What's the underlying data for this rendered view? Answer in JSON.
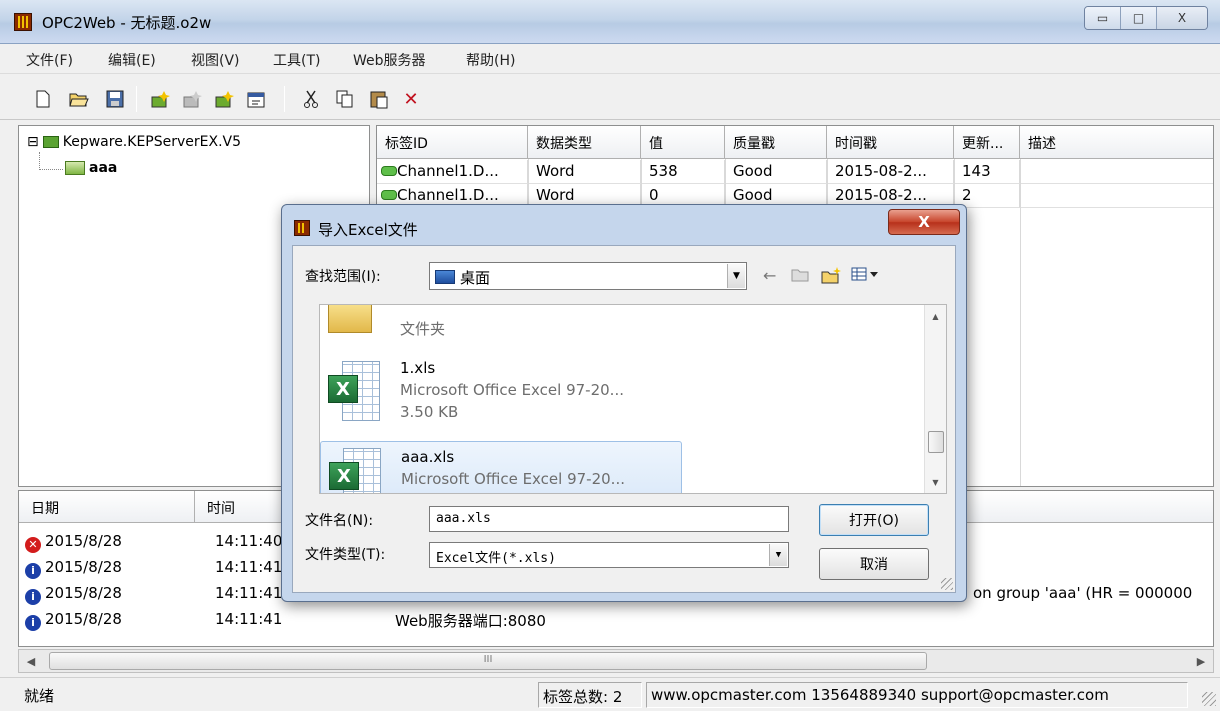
{
  "window": {
    "title": "OPC2Web - 无标题.o2w",
    "controls": {
      "minimize": "▭",
      "maximize": "□",
      "close": "X"
    }
  },
  "menu": [
    "文件(F)",
    "编辑(E)",
    "视图(V)",
    "工具(T)",
    "Web服务器",
    "帮助(H)"
  ],
  "toolbar": {
    "icons": [
      "new-icon",
      "open-icon",
      "save-icon",
      "add-group-icon",
      "add-tag-icon",
      "import-icon",
      "properties-icon",
      "cut-icon",
      "copy-icon",
      "paste-icon",
      "delete-icon"
    ]
  },
  "tree": {
    "root": "Kepware.KEPServerEX.V5",
    "expander": "⊟",
    "child": "aaa"
  },
  "tag_grid": {
    "columns": [
      "标签ID",
      "数据类型",
      "值",
      "质量戳",
      "时间戳",
      "更新...",
      "描述"
    ],
    "rows": [
      [
        "Channel1.D...",
        "Word",
        "538",
        "Good",
        "2015-08-2...",
        "143",
        ""
      ],
      [
        "Channel1.D...",
        "Word",
        "0",
        "Good",
        "2015-08-2...",
        "2",
        ""
      ]
    ]
  },
  "log": {
    "columns": [
      "日期",
      "时间"
    ],
    "rows": [
      {
        "type": "error",
        "date": "2015/8/28",
        "time": "14:11:40",
        "message": ""
      },
      {
        "type": "info",
        "date": "2015/8/28",
        "time": "14:11:41",
        "message": ""
      },
      {
        "type": "info",
        "date": "2015/8/28",
        "time": "14:11:41",
        "message": "on group 'aaa' (HR = 000000"
      },
      {
        "type": "info",
        "date": "2015/8/28",
        "time": "14:11:41",
        "message": "Web服务器端口:8080"
      }
    ],
    "scroll_thumb_grip": "III"
  },
  "status": {
    "ready": "就绪",
    "tag_count": "标签总数: 2",
    "contact": "www.opcmaster.com 13564889340 support@opcmaster.com"
  },
  "dialog": {
    "title": "导入Excel文件",
    "close": "X",
    "look_in_label": "查找范围(I):",
    "look_in_value": "桌面",
    "files": [
      {
        "kind": "folder",
        "name": "",
        "subtitle": "文件夹"
      },
      {
        "kind": "xls",
        "name": "1.xls",
        "subtitle": "Microsoft Office Excel 97-20...",
        "size": "3.50 KB"
      },
      {
        "kind": "xls",
        "name": "aaa.xls",
        "subtitle": "Microsoft Office Excel 97-20...",
        "selected": true
      }
    ],
    "filename_label": "文件名(N):",
    "filename_value": "aaa.xls",
    "filetype_label": "文件类型(T):",
    "filetype_value": "Excel文件(*.xls)",
    "open_button": "打开(O)",
    "cancel_button": "取消"
  }
}
